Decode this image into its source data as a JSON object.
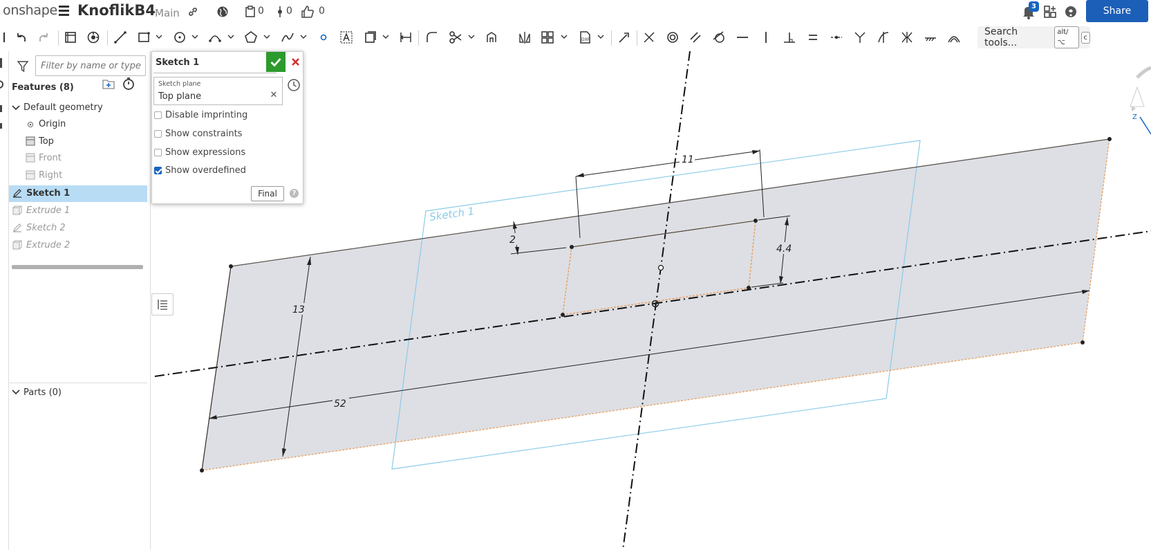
{
  "header": {
    "logo": "onshape",
    "doc_title": "KnoflikB4",
    "branch": "Main",
    "versions_count": "0",
    "branches_count": "0",
    "likes_count": "0",
    "notifications_count": "3",
    "share_label": "Share"
  },
  "toolbar": {
    "search_label": "Search tools...",
    "search_kbd_1": "alt/⌥",
    "search_kbd_2": "c"
  },
  "feature_panel": {
    "filter_placeholder": "Filter by name or type",
    "features_title": "Features (8)",
    "tree": [
      {
        "label": "Default geometry"
      },
      {
        "label": "Origin"
      },
      {
        "label": "Top"
      },
      {
        "label": "Front"
      },
      {
        "label": "Right"
      },
      {
        "label": "Sketch 1"
      },
      {
        "label": "Extrude 1"
      },
      {
        "label": "Sketch 2"
      },
      {
        "label": "Extrude 2"
      }
    ],
    "parts_title": "Parts (0)"
  },
  "sketch_dialog": {
    "title": "Sketch 1",
    "plane_label": "Sketch plane",
    "plane_value": "Top plane",
    "options": [
      {
        "label": "Disable imprinting",
        "checked": false
      },
      {
        "label": "Show constraints",
        "checked": false
      },
      {
        "label": "Show expressions",
        "checked": false
      },
      {
        "label": "Show overdefined",
        "checked": true
      }
    ],
    "final_label": "Final"
  },
  "viewport": {
    "plane_label": "Sketch 1",
    "dimensions": {
      "width_top": "11",
      "offset_small": "2",
      "height_small": "4.4",
      "height_large": "13",
      "width_large": "52"
    },
    "view_cube_axis": "Z"
  },
  "colors": {
    "accent": "#1b5fb8",
    "confirm_green": "#2c9a2c",
    "cancel_red": "#d32f2f",
    "selection": "#b8dcf4",
    "sketch_fill": "#dddfe4",
    "sketch_edge": "#e8a060",
    "plane_outline": "#8ccbe8"
  }
}
